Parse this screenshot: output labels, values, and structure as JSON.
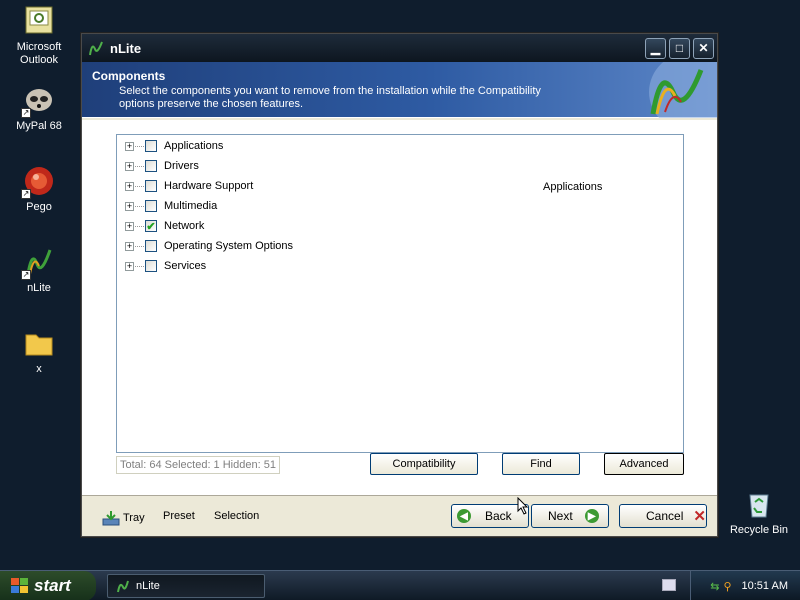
{
  "desktop": {
    "icons": [
      {
        "label": "Microsoft Outlook",
        "icon": "outlook-icon"
      },
      {
        "label": "MyPal 68",
        "icon": "mypal-icon"
      },
      {
        "label": "Pego",
        "icon": "pego-icon"
      },
      {
        "label": "nLite",
        "icon": "nlite-icon"
      },
      {
        "label": "x",
        "icon": "folder-icon"
      },
      {
        "label": "Recycle Bin",
        "icon": "recycle-bin-icon"
      }
    ]
  },
  "window": {
    "title": "nLite",
    "header": {
      "title": "Components",
      "description": "Select the components you want to remove from the installation while the Compatibility options preserve the chosen features."
    },
    "tree": [
      {
        "label": "Applications",
        "checked": false
      },
      {
        "label": "Drivers",
        "checked": false
      },
      {
        "label": "Hardware Support",
        "checked": false
      },
      {
        "label": "Multimedia",
        "checked": false
      },
      {
        "label": "Network",
        "checked": true
      },
      {
        "label": "Operating System Options",
        "checked": false
      },
      {
        "label": "Services",
        "checked": false
      }
    ],
    "detail_label": "Applications",
    "stats": "Total: 64 Selected: 1 Hidden: 51",
    "buttons": {
      "compatibility": "Compatibility",
      "find": "Find",
      "advanced": "Advanced"
    },
    "footer": {
      "tray": "Tray",
      "preset": "Preset",
      "selection": "Selection",
      "back": "Back",
      "next": "Next",
      "cancel": "Cancel"
    }
  },
  "taskbar": {
    "start": "start",
    "task": "nLite",
    "clock": "10:51 AM"
  }
}
